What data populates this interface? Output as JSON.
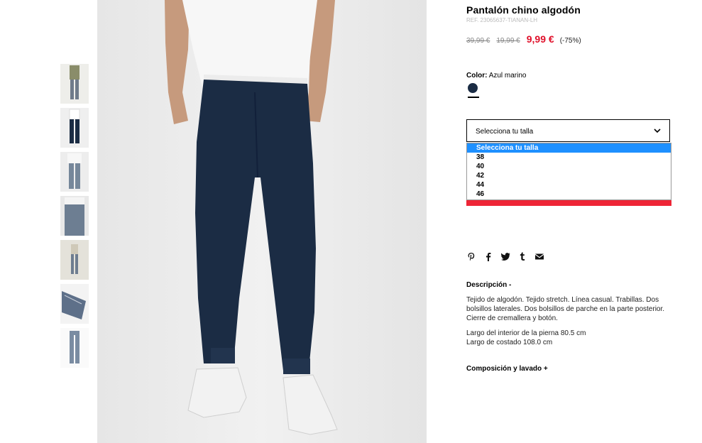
{
  "product": {
    "title": "Pantalón chino algodón",
    "ref": "REF. 23065637-TIANAN-LH",
    "price_original_1": "39,99 €",
    "price_original_2": "19,99 €",
    "price_current": "9,99 €",
    "discount": "(-75%)"
  },
  "color": {
    "label": "Color:",
    "value": "Azul marino",
    "swatch_hex": "#1b2c44"
  },
  "size_select": {
    "selected": "Selecciona tu talla",
    "options": [
      "Selecciona tu talla",
      "38",
      "40",
      "42",
      "44",
      "46"
    ]
  },
  "social_icons": [
    "pinterest-icon",
    "facebook-icon",
    "twitter-icon",
    "tumblr-icon",
    "email-icon"
  ],
  "description": {
    "heading": "Descripción -",
    "text": "Tejido de algodón. Tejido stretch. Línea casual. Trabillas. Dos bolsillos laterales. Dos bolsillos de parche en la parte posterior. Cierre de cremallera y botón.",
    "measure_1": "Largo del interior de la pierna 80.5 cm",
    "measure_2": "Largo de costado 108.0 cm"
  },
  "composition": {
    "heading": "Composición y lavado +"
  },
  "colors": {
    "accent_red": "#e0102a",
    "bar_red": "#ee2536",
    "select_highlight": "#1e90ff",
    "pants_navy": "#1b2c44"
  }
}
